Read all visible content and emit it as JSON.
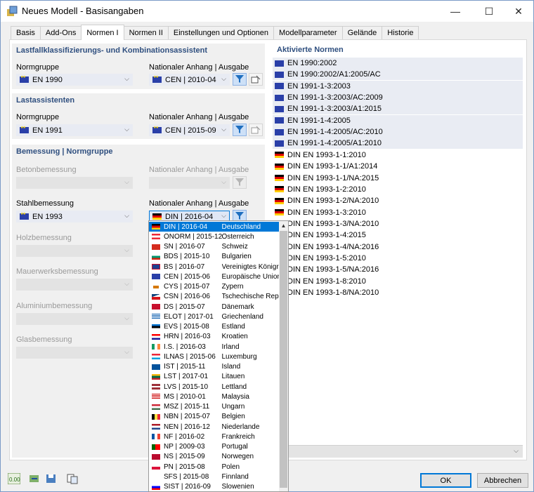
{
  "window": {
    "title": "Neues Modell - Basisangaben",
    "minimize": "—",
    "maximize": "☐",
    "close": "✕"
  },
  "tabs": [
    "Basis",
    "Add-Ons",
    "Normen I",
    "Normen II",
    "Einstellungen und Optionen",
    "Modellparameter",
    "Gelände",
    "Historie"
  ],
  "active_tab": "Normen I",
  "combi": {
    "title": "Lastfallklassifizierungs- und Kombinationsassistent",
    "norm_label": "Normgruppe",
    "norm_value": "EN 1990",
    "annex_label": "Nationaler Anhang | Ausgabe",
    "annex_value": "CEN | 2010-04"
  },
  "load": {
    "title": "Lastassistenten",
    "norm_label": "Normgruppe",
    "norm_value": "EN 1991",
    "annex_label": "Nationaler Anhang | Ausgabe",
    "annex_value": "CEN | 2015-09"
  },
  "design": {
    "title": "Bemessung | Normgruppe",
    "concrete_label": "Betonbemessung",
    "concrete_annex_label": "Nationaler Anhang | Ausgabe",
    "steel_label": "Stahlbemessung",
    "steel_value": "EN 1993",
    "steel_annex_label": "Nationaler Anhang | Ausgabe",
    "steel_annex_value": "DIN | 2016-04",
    "timber_label": "Holzbemessung",
    "masonry_label": "Mauerwerksbemessung",
    "aluminium_label": "Aluminiumbemessung",
    "glass_label": "Glasbemessung"
  },
  "activated": {
    "title": "Aktivierte Normen",
    "items": [
      {
        "flag": "eu",
        "text": "EN 1990:2002"
      },
      {
        "flag": "eu",
        "text": "EN 1990:2002/A1:2005/AC"
      },
      {
        "flag": "eu",
        "text": "EN 1991-1-3:2003"
      },
      {
        "flag": "eu",
        "text": "EN 1991-1-3:2003/AC:2009"
      },
      {
        "flag": "eu",
        "text": "EN 1991-1-3:2003/A1:2015"
      },
      {
        "flag": "eu",
        "text": "EN 1991-1-4:2005"
      },
      {
        "flag": "eu",
        "text": "EN 1991-1-4:2005/AC:2010"
      },
      {
        "flag": "eu",
        "text": "EN 1991-1-4:2005/A1:2010"
      },
      {
        "flag": "de",
        "text": "DIN EN 1993-1-1:2010"
      },
      {
        "flag": "de",
        "text": "DIN EN 1993-1-1/A1:2014"
      },
      {
        "flag": "de",
        "text": "DIN EN 1993-1-1/NA:2015"
      },
      {
        "flag": "de",
        "text": "DIN EN 1993-1-2:2010"
      },
      {
        "flag": "de",
        "text": "DIN EN 1993-1-2/NA:2010"
      },
      {
        "flag": "de",
        "text": "DIN EN 1993-1-3:2010"
      },
      {
        "flag": "de",
        "text": "DIN EN 1993-1-3/NA:2010"
      },
      {
        "flag": "de",
        "text": "DIN EN 1993-1-4:2015"
      },
      {
        "flag": "de",
        "text": "DIN EN 1993-1-4/NA:2016"
      },
      {
        "flag": "de",
        "text": "DIN EN 1993-1-5:2010"
      },
      {
        "flag": "de",
        "text": "DIN EN 1993-1-5/NA:2016"
      },
      {
        "flag": "de",
        "text": "DIN EN 1993-1-8:2010"
      },
      {
        "flag": "de",
        "text": "DIN EN 1993-1-8/NA:2010"
      }
    ]
  },
  "dropdown": {
    "items": [
      {
        "flag": "de",
        "code": "DIN | 2016-04",
        "country": "Deutschland",
        "selected": true
      },
      {
        "flag": "at",
        "code": "ÖNORM | 2015-12",
        "country": "Österreich"
      },
      {
        "flag": "ch",
        "code": "SN | 2016-07",
        "country": "Schweiz"
      },
      {
        "flag": "bg",
        "code": "BDS | 2015-10",
        "country": "Bulgarien"
      },
      {
        "flag": "gb",
        "code": "BS | 2016-07",
        "country": "Vereinigtes Königreich"
      },
      {
        "flag": "eu",
        "code": "CEN | 2015-06",
        "country": "Europäische Union"
      },
      {
        "flag": "cy",
        "code": "CYS | 2015-07",
        "country": "Zypern"
      },
      {
        "flag": "cz",
        "code": "ČSN | 2016-06",
        "country": "Tschechische Republik"
      },
      {
        "flag": "dk",
        "code": "DS | 2015-07",
        "country": "Dänemark"
      },
      {
        "flag": "gr",
        "code": "ELOT | 2017-01",
        "country": "Griechenland"
      },
      {
        "flag": "ee",
        "code": "EVS | 2015-08",
        "country": "Estland"
      },
      {
        "flag": "hr",
        "code": "HRN | 2016-03",
        "country": "Kroatien"
      },
      {
        "flag": "ie",
        "code": "I.S. | 2016-03",
        "country": "Irland"
      },
      {
        "flag": "lu",
        "code": "ILNAS | 2015-06",
        "country": "Luxemburg"
      },
      {
        "flag": "is",
        "code": "ÍST | 2015-11",
        "country": "Island"
      },
      {
        "flag": "lt",
        "code": "LST | 2017-01",
        "country": "Litauen"
      },
      {
        "flag": "lv",
        "code": "LVS | 2015-10",
        "country": "Lettland"
      },
      {
        "flag": "my",
        "code": "MS | 2010-01",
        "country": "Malaysia"
      },
      {
        "flag": "hu",
        "code": "MSZ | 2015-11",
        "country": "Ungarn"
      },
      {
        "flag": "be",
        "code": "NBN | 2015-07",
        "country": "Belgien"
      },
      {
        "flag": "nl",
        "code": "NEN | 2016-12",
        "country": "Niederlande"
      },
      {
        "flag": "fr",
        "code": "NF | 2016-02",
        "country": "Frankreich"
      },
      {
        "flag": "pt",
        "code": "NP | 2009-03",
        "country": "Portugal"
      },
      {
        "flag": "no",
        "code": "NS | 2015-09",
        "country": "Norwegen"
      },
      {
        "flag": "pl",
        "code": "PN | 2015-08",
        "country": "Polen"
      },
      {
        "flag": "fi",
        "code": "SFS | 2015-08",
        "country": "Finnland"
      },
      {
        "flag": "si",
        "code": "SIST | 2016-09",
        "country": "Slowenien"
      }
    ]
  },
  "buttons": {
    "ok": "OK",
    "cancel": "Abbrechen"
  },
  "colors": {
    "accent": "#0078d7",
    "group_title": "#2f4f7f",
    "eu_blue": "#2a3fa8"
  }
}
